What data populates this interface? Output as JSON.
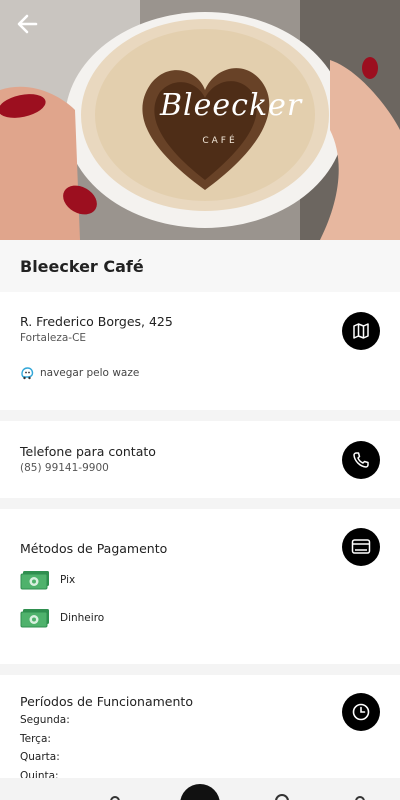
{
  "header": {
    "logo_text": "Bleecker",
    "logo_sub": "CAFÉ"
  },
  "place": {
    "name": "Bleecker Café"
  },
  "address": {
    "street": "R. Frederico Borges, 425",
    "city": "Fortaleza-CE",
    "waze_label": "navegar pelo waze"
  },
  "contact": {
    "label": "Telefone para contato",
    "phone": "(85) 99141-9900"
  },
  "payment": {
    "label": "Métodos de Pagamento",
    "methods": [
      "Pix",
      "Dinheiro"
    ]
  },
  "hours": {
    "label": "Períodos de Funcionamento",
    "days": [
      "Segunda:",
      "Terça:",
      "Quarta:",
      "Quinta:"
    ]
  },
  "icons": {
    "back": "arrow-left-icon",
    "map": "map-icon",
    "phone": "phone-icon",
    "payment": "card-icon",
    "clock": "clock-icon",
    "waze": "waze-icon",
    "money": "money-icon"
  },
  "colors": {
    "accent": "#000000",
    "money_green": "#3aa35b",
    "waze_blue": "#33ccff"
  }
}
